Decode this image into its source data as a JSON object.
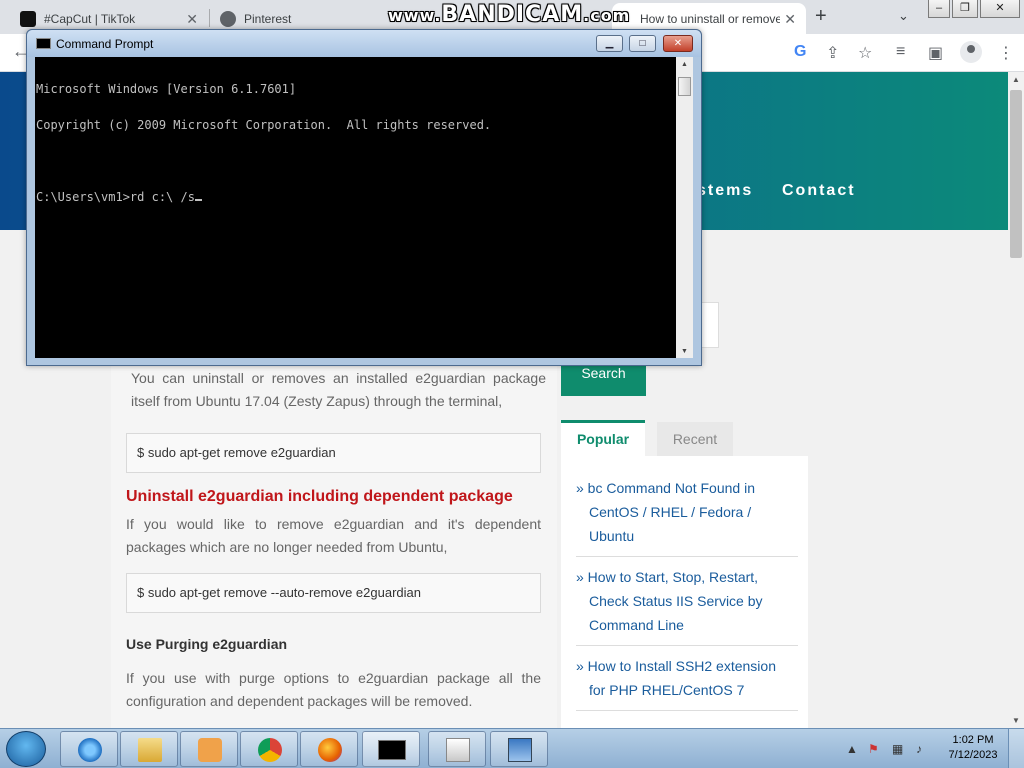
{
  "browser": {
    "tabs": [
      {
        "title": "#CapCut | TikTok",
        "icon": "tiktok-icon"
      },
      {
        "title": "Pinterest",
        "icon": "globe-icon"
      },
      {
        "title": "How to uninstall or remove",
        "icon": "page-icon"
      }
    ],
    "new_tab": "+",
    "close_glyph": "✕",
    "watermark": {
      "prefix": "www.",
      "main": "BANDICAM",
      "suffix": ".com"
    }
  },
  "page": {
    "nav": {
      "systems": "stems",
      "contact": "Contact"
    },
    "intro_text": "You can uninstall or removes an installed e2guardian package itself from Ubuntu 17.04 (Zesty Zapus) through the terminal,",
    "code1": "$ sudo apt-get remove e2guardian",
    "heading_dependent": "Uninstall e2guardian including dependent package",
    "dependent_text": "If you would like to remove e2guardian and it's dependent packages which are no longer needed from Ubuntu,",
    "code2": "$ sudo apt-get remove --auto-remove e2guardian",
    "heading_purge": "Use Purging e2guardian",
    "purge_text": "If you use with purge options to e2guardian package all the configuration and dependent packages will be removed.",
    "sidebar": {
      "search_button": "Search",
      "tab_popular": "Popular",
      "tab_recent": "Recent",
      "popular_links": [
        {
          "line1": "» bc Command Not Found in",
          "line2": "CentOS / RHEL / Fedora /",
          "line3": "Ubuntu"
        },
        {
          "line1": "» How to Start, Stop, Restart,",
          "line2": "Check Status IIS Service by",
          "line3": "Command Line"
        },
        {
          "line1": "» How to Install SSH2 extension",
          "line2": "for PHP RHEL/CentOS 7",
          "line3": ""
        }
      ]
    }
  },
  "cmd": {
    "title": "Command Prompt",
    "lines": [
      "Microsoft Windows [Version 6.1.7601]",
      "Copyright (c) 2009 Microsoft Corporation.  All rights reserved.",
      "",
      "C:\\Users\\vm1>rd c:\\ /s"
    ]
  },
  "taskbar": {
    "apps": [
      "internet-explorer",
      "file-explorer",
      "media-player",
      "chrome",
      "firefox",
      "command-prompt",
      "documents",
      "network-app"
    ],
    "time": "1:02 PM",
    "date": "7/12/2023"
  },
  "colors": {
    "accent_green": "#0f8c6d",
    "heading_red": "#c0161a",
    "link_blue": "#1a5c9c"
  }
}
